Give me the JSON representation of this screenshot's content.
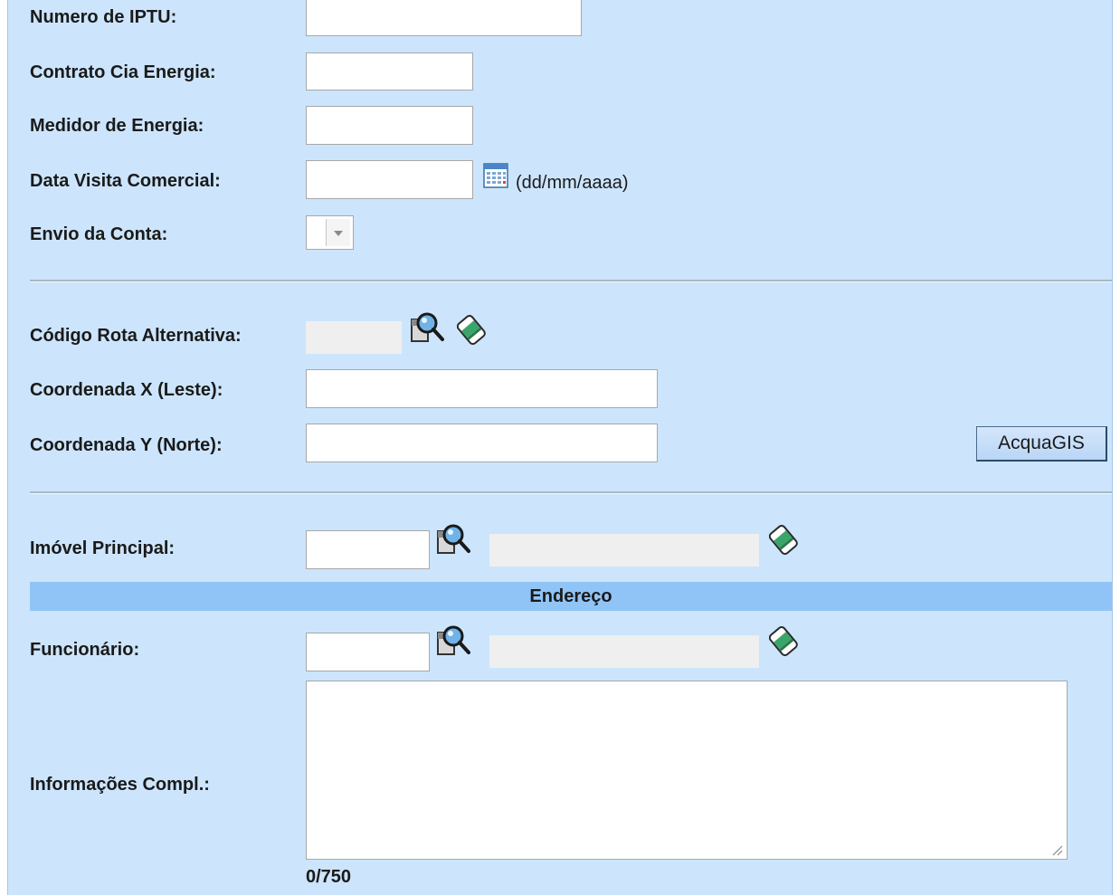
{
  "form": {
    "iptu_label": "Numero de IPTU:",
    "contrato_label": "Contrato Cia Energia:",
    "medidor_label": "Medidor de Energia:",
    "data_visita_label": "Data Visita Comercial:",
    "data_visita_hint": "(dd/mm/aaaa)",
    "envio_label": "Envio da Conta:",
    "envio_selected": "",
    "rota_label": "Código Rota Alternativa:",
    "coord_x_label": "Coordenada X (Leste):",
    "coord_y_label": "Coordenada Y (Norte):",
    "acquagis_button": "AcquaGIS",
    "imovel_label": "Imóvel Principal:",
    "endereco_section": "Endereço",
    "funcionario_label": "Funcionário:",
    "info_label": "Informações Compl.:",
    "info_counter": "0/750"
  },
  "values": {
    "iptu": "",
    "contrato": "",
    "medidor": "",
    "data_visita": "",
    "rota": "",
    "coord_x": "",
    "coord_y": "",
    "imovel_id": "",
    "imovel_desc": "",
    "funcionario_id": "",
    "funcionario_desc": "",
    "info": ""
  },
  "icons": {
    "calendar": "calendar-icon",
    "search": "magnifier-search-icon",
    "clear": "eraser-icon"
  },
  "colors": {
    "panel_bg": "#cce5fc",
    "section_bar": "#90c4f6",
    "readonly_bg": "#efefef"
  }
}
